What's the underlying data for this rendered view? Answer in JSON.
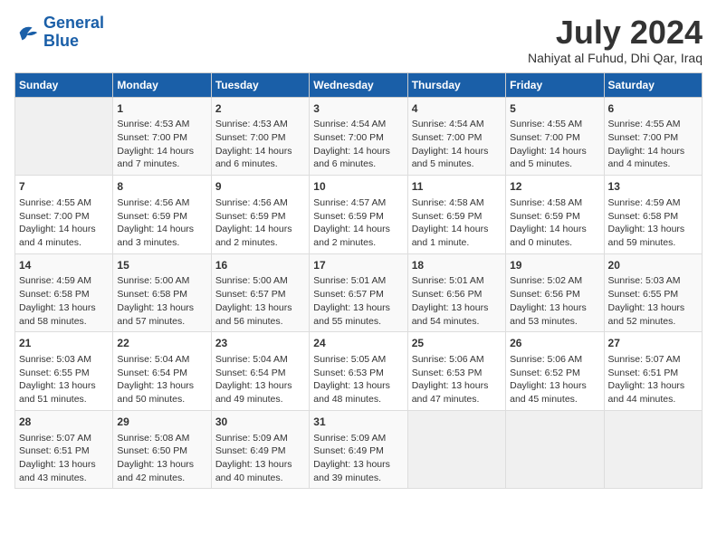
{
  "logo": {
    "line1": "General",
    "line2": "Blue"
  },
  "title": "July 2024",
  "location": "Nahiyat al Fuhud, Dhi Qar, Iraq",
  "weekdays": [
    "Sunday",
    "Monday",
    "Tuesday",
    "Wednesday",
    "Thursday",
    "Friday",
    "Saturday"
  ],
  "weeks": [
    [
      {
        "day": "",
        "content": ""
      },
      {
        "day": "1",
        "content": "Sunrise: 4:53 AM\nSunset: 7:00 PM\nDaylight: 14 hours\nand 7 minutes."
      },
      {
        "day": "2",
        "content": "Sunrise: 4:53 AM\nSunset: 7:00 PM\nDaylight: 14 hours\nand 6 minutes."
      },
      {
        "day": "3",
        "content": "Sunrise: 4:54 AM\nSunset: 7:00 PM\nDaylight: 14 hours\nand 6 minutes."
      },
      {
        "day": "4",
        "content": "Sunrise: 4:54 AM\nSunset: 7:00 PM\nDaylight: 14 hours\nand 5 minutes."
      },
      {
        "day": "5",
        "content": "Sunrise: 4:55 AM\nSunset: 7:00 PM\nDaylight: 14 hours\nand 5 minutes."
      },
      {
        "day": "6",
        "content": "Sunrise: 4:55 AM\nSunset: 7:00 PM\nDaylight: 14 hours\nand 4 minutes."
      }
    ],
    [
      {
        "day": "7",
        "content": "Sunrise: 4:55 AM\nSunset: 7:00 PM\nDaylight: 14 hours\nand 4 minutes."
      },
      {
        "day": "8",
        "content": "Sunrise: 4:56 AM\nSunset: 6:59 PM\nDaylight: 14 hours\nand 3 minutes."
      },
      {
        "day": "9",
        "content": "Sunrise: 4:56 AM\nSunset: 6:59 PM\nDaylight: 14 hours\nand 2 minutes."
      },
      {
        "day": "10",
        "content": "Sunrise: 4:57 AM\nSunset: 6:59 PM\nDaylight: 14 hours\nand 2 minutes."
      },
      {
        "day": "11",
        "content": "Sunrise: 4:58 AM\nSunset: 6:59 PM\nDaylight: 14 hours\nand 1 minute."
      },
      {
        "day": "12",
        "content": "Sunrise: 4:58 AM\nSunset: 6:59 PM\nDaylight: 14 hours\nand 0 minutes."
      },
      {
        "day": "13",
        "content": "Sunrise: 4:59 AM\nSunset: 6:58 PM\nDaylight: 13 hours\nand 59 minutes."
      }
    ],
    [
      {
        "day": "14",
        "content": "Sunrise: 4:59 AM\nSunset: 6:58 PM\nDaylight: 13 hours\nand 58 minutes."
      },
      {
        "day": "15",
        "content": "Sunrise: 5:00 AM\nSunset: 6:58 PM\nDaylight: 13 hours\nand 57 minutes."
      },
      {
        "day": "16",
        "content": "Sunrise: 5:00 AM\nSunset: 6:57 PM\nDaylight: 13 hours\nand 56 minutes."
      },
      {
        "day": "17",
        "content": "Sunrise: 5:01 AM\nSunset: 6:57 PM\nDaylight: 13 hours\nand 55 minutes."
      },
      {
        "day": "18",
        "content": "Sunrise: 5:01 AM\nSunset: 6:56 PM\nDaylight: 13 hours\nand 54 minutes."
      },
      {
        "day": "19",
        "content": "Sunrise: 5:02 AM\nSunset: 6:56 PM\nDaylight: 13 hours\nand 53 minutes."
      },
      {
        "day": "20",
        "content": "Sunrise: 5:03 AM\nSunset: 6:55 PM\nDaylight: 13 hours\nand 52 minutes."
      }
    ],
    [
      {
        "day": "21",
        "content": "Sunrise: 5:03 AM\nSunset: 6:55 PM\nDaylight: 13 hours\nand 51 minutes."
      },
      {
        "day": "22",
        "content": "Sunrise: 5:04 AM\nSunset: 6:54 PM\nDaylight: 13 hours\nand 50 minutes."
      },
      {
        "day": "23",
        "content": "Sunrise: 5:04 AM\nSunset: 6:54 PM\nDaylight: 13 hours\nand 49 minutes."
      },
      {
        "day": "24",
        "content": "Sunrise: 5:05 AM\nSunset: 6:53 PM\nDaylight: 13 hours\nand 48 minutes."
      },
      {
        "day": "25",
        "content": "Sunrise: 5:06 AM\nSunset: 6:53 PM\nDaylight: 13 hours\nand 47 minutes."
      },
      {
        "day": "26",
        "content": "Sunrise: 5:06 AM\nSunset: 6:52 PM\nDaylight: 13 hours\nand 45 minutes."
      },
      {
        "day": "27",
        "content": "Sunrise: 5:07 AM\nSunset: 6:51 PM\nDaylight: 13 hours\nand 44 minutes."
      }
    ],
    [
      {
        "day": "28",
        "content": "Sunrise: 5:07 AM\nSunset: 6:51 PM\nDaylight: 13 hours\nand 43 minutes."
      },
      {
        "day": "29",
        "content": "Sunrise: 5:08 AM\nSunset: 6:50 PM\nDaylight: 13 hours\nand 42 minutes."
      },
      {
        "day": "30",
        "content": "Sunrise: 5:09 AM\nSunset: 6:49 PM\nDaylight: 13 hours\nand 40 minutes."
      },
      {
        "day": "31",
        "content": "Sunrise: 5:09 AM\nSunset: 6:49 PM\nDaylight: 13 hours\nand 39 minutes."
      },
      {
        "day": "",
        "content": ""
      },
      {
        "day": "",
        "content": ""
      },
      {
        "day": "",
        "content": ""
      }
    ]
  ]
}
